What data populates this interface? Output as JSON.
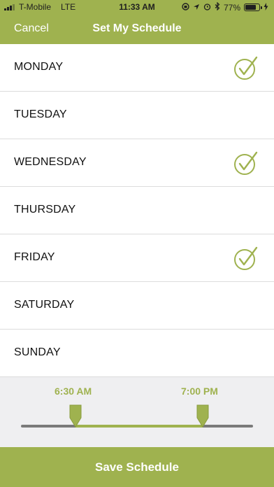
{
  "status_bar": {
    "carrier": "T-Mobile",
    "network": "LTE",
    "time": "11:33 AM",
    "battery_percent": "77%",
    "battery_level": 0.77
  },
  "nav": {
    "cancel_label": "Cancel",
    "title": "Set My Schedule"
  },
  "days": [
    {
      "label": "MONDAY",
      "selected": true
    },
    {
      "label": "TUESDAY",
      "selected": false
    },
    {
      "label": "WEDNESDAY",
      "selected": true
    },
    {
      "label": "THURSDAY",
      "selected": false
    },
    {
      "label": "FRIDAY",
      "selected": true
    },
    {
      "label": "SATURDAY",
      "selected": false
    },
    {
      "label": "SUNDAY",
      "selected": false
    }
  ],
  "time_range": {
    "start_label": "6:30 AM",
    "end_label": "7:00 PM"
  },
  "save_label": "Save Schedule",
  "colors": {
    "accent": "#9fb24f",
    "panel": "#efeff1",
    "track": "#7a7a7a"
  }
}
